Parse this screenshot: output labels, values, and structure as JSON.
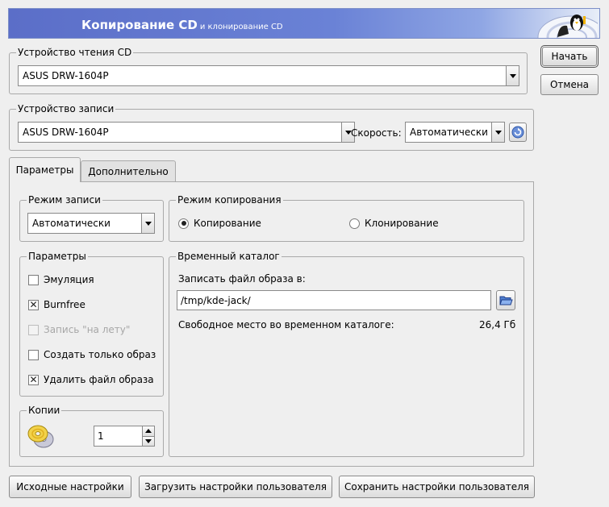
{
  "header": {
    "title": "Копирование CD",
    "subtitle": "и клонирование CD",
    "logo_icon": "tux-cd-logo-icon"
  },
  "reader": {
    "group_title": "Устройство чтения CD",
    "device": "ASUS DRW-1604P"
  },
  "writer": {
    "group_title": "Устройство записи",
    "device": "ASUS DRW-1604P",
    "speed_label": "Скорость:",
    "speed_value": "Автоматически",
    "refresh_icon": "refresh-icon"
  },
  "side_buttons": {
    "start": "Начать",
    "cancel": "Отмена"
  },
  "tabs": [
    {
      "label": "Параметры",
      "active": true
    },
    {
      "label": "Дополнительно",
      "active": false
    }
  ],
  "write_mode": {
    "group_title": "Режим записи",
    "value": "Автоматически"
  },
  "copy_mode": {
    "group_title": "Режим копирования",
    "options": [
      {
        "label": "Копирование",
        "selected": true
      },
      {
        "label": "Клонирование",
        "selected": false
      }
    ]
  },
  "params": {
    "group_title": "Параметры",
    "options": [
      {
        "label": "Эмуляция",
        "checked": false,
        "enabled": true
      },
      {
        "label": "Burnfree",
        "checked": true,
        "enabled": true
      },
      {
        "label": "Запись \"на лету\"",
        "checked": false,
        "enabled": false
      },
      {
        "label": "Создать только образ",
        "checked": false,
        "enabled": true
      },
      {
        "label": "Удалить файл образа",
        "checked": true,
        "enabled": true
      }
    ]
  },
  "temp_dir": {
    "group_title": "Временный каталог",
    "write_label": "Записать файл образа в:",
    "path": "/tmp/kde-jack/",
    "free_label": "Свободное место во временном каталоге:",
    "free_value": "26,4 Гб",
    "browse_icon": "folder-open-icon"
  },
  "copies": {
    "group_title": "Копии",
    "value": "1",
    "icon": "cd-copies-icon"
  },
  "bottom_buttons": {
    "defaults": "Исходные настройки",
    "load_user": "Загрузить настройки пользователя",
    "save_user": "Сохранить настройки пользователя"
  }
}
